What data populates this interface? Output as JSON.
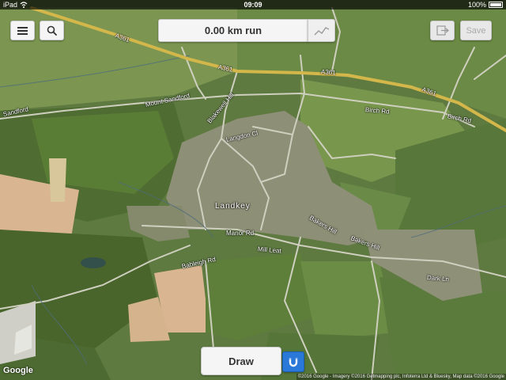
{
  "status_bar": {
    "device": "iPad",
    "time": "09:09",
    "battery_text": "100%"
  },
  "toolbar": {
    "distance_label": "0.00 km run",
    "save_label": "Save"
  },
  "map": {
    "town_label": "Landkey",
    "road_labels": {
      "a361_left": "A361",
      "a361_mid": "A361",
      "a361_right_1": "A361",
      "a361_right_2": "A361",
      "mount_sandford": "Mount Sandford",
      "sandford": "Sandford",
      "birch_rd_1": "Birch Rd",
      "birch_rd_2": "Birch Rd",
      "manor_rd": "Manor Rd",
      "mill_leat": "Mill Leat",
      "blakewell": "Blakewell Hill",
      "langdon": "Langdon Cl",
      "bakers_hill": "Bakers Hill",
      "bakers_hill_2": "Bakers Hill",
      "dark_lane": "Dark Ln",
      "bableigh": "Bableigh Rd"
    },
    "colors": {
      "route_highway": "#d4b74a",
      "field_light": "#8aa35c",
      "field_dark": "#4e6a34",
      "bare_soil": "#d9b592"
    }
  },
  "bottom": {
    "draw_label": "Draw",
    "google_logo": "Google",
    "attribution": "©2016 Google - Imagery ©2016 Getmapping plc, Infoterra Ltd & Bluesky, Map data ©2016 Google"
  },
  "icons": {
    "menu": "hamburger-icon",
    "search": "search-icon",
    "chart": "elevation-chart-icon",
    "export": "export-icon",
    "magnet": "magnet-icon"
  }
}
